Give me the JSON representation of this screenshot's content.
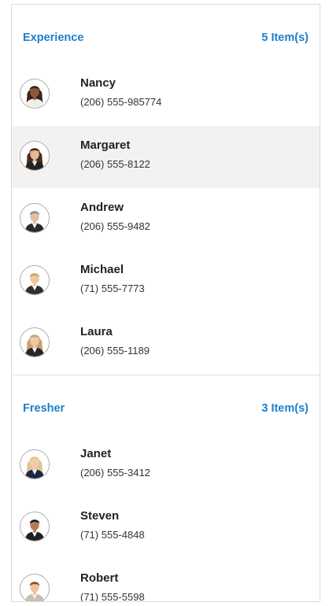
{
  "groups": [
    {
      "title": "Experience",
      "count": "5 Item(s)",
      "items": [
        {
          "name": "Nancy",
          "phone": "(206) 555-985774",
          "avatar": "female-contact-avatar",
          "hair": "#3a2418",
          "shirt": "#e8e6e2",
          "jacket": "#f0efec",
          "skin": "#8a5a3f",
          "selected": false
        },
        {
          "name": "Margaret",
          "phone": "(206) 555-8122",
          "avatar": "female-contact-avatar",
          "hair": "#4a2c1c",
          "shirt": "#f2f2f2",
          "jacket": "#222222",
          "skin": "#e6b896",
          "selected": true
        },
        {
          "name": "Andrew",
          "phone": "(206) 555-9482",
          "avatar": "male-contact-avatar",
          "hair": "#8b8b8b",
          "shirt": "#ffffff",
          "jacket": "#2b2b2b",
          "skin": "#e5bfa0",
          "selected": false
        },
        {
          "name": "Michael",
          "phone": "(71) 555-7773",
          "avatar": "male-contact-avatar",
          "hair": "#c9a46a",
          "shirt": "#ffffff",
          "jacket": "#2e2e2e",
          "skin": "#efc6a4",
          "selected": false
        },
        {
          "name": "Laura",
          "phone": "(206) 555-1189",
          "avatar": "female-contact-avatar",
          "hair": "#c9a26a",
          "shirt": "#f4f4f4",
          "jacket": "#262626",
          "skin": "#efc8a6",
          "selected": false
        }
      ]
    },
    {
      "title": "Fresher",
      "count": "3 Item(s)",
      "items": [
        {
          "name": "Janet",
          "phone": "(206) 555-3412",
          "avatar": "female-contact-avatar",
          "hair": "#e1c58c",
          "shirt": "#f4f4f4",
          "jacket": "#1a2a44",
          "skin": "#f1cdb0",
          "selected": false
        },
        {
          "name": "Steven",
          "phone": "(71) 555-4848",
          "avatar": "male-contact-avatar",
          "hair": "#1a1a1a",
          "shirt": "#ffffff",
          "jacket": "#1f1f1f",
          "skin": "#b57a55",
          "selected": false
        },
        {
          "name": "Robert",
          "phone": "(71) 555-5598",
          "avatar": "male-contact-avatar",
          "hair": "#7a5234",
          "shirt": "#f2f2f2",
          "jacket": "#c9bfae",
          "skin": "#ecc3a1",
          "selected": false
        }
      ]
    }
  ],
  "colors": {
    "accent": "#1f7fc8",
    "selected_row": "#f3f2f0",
    "border": "#dcdcdc"
  }
}
